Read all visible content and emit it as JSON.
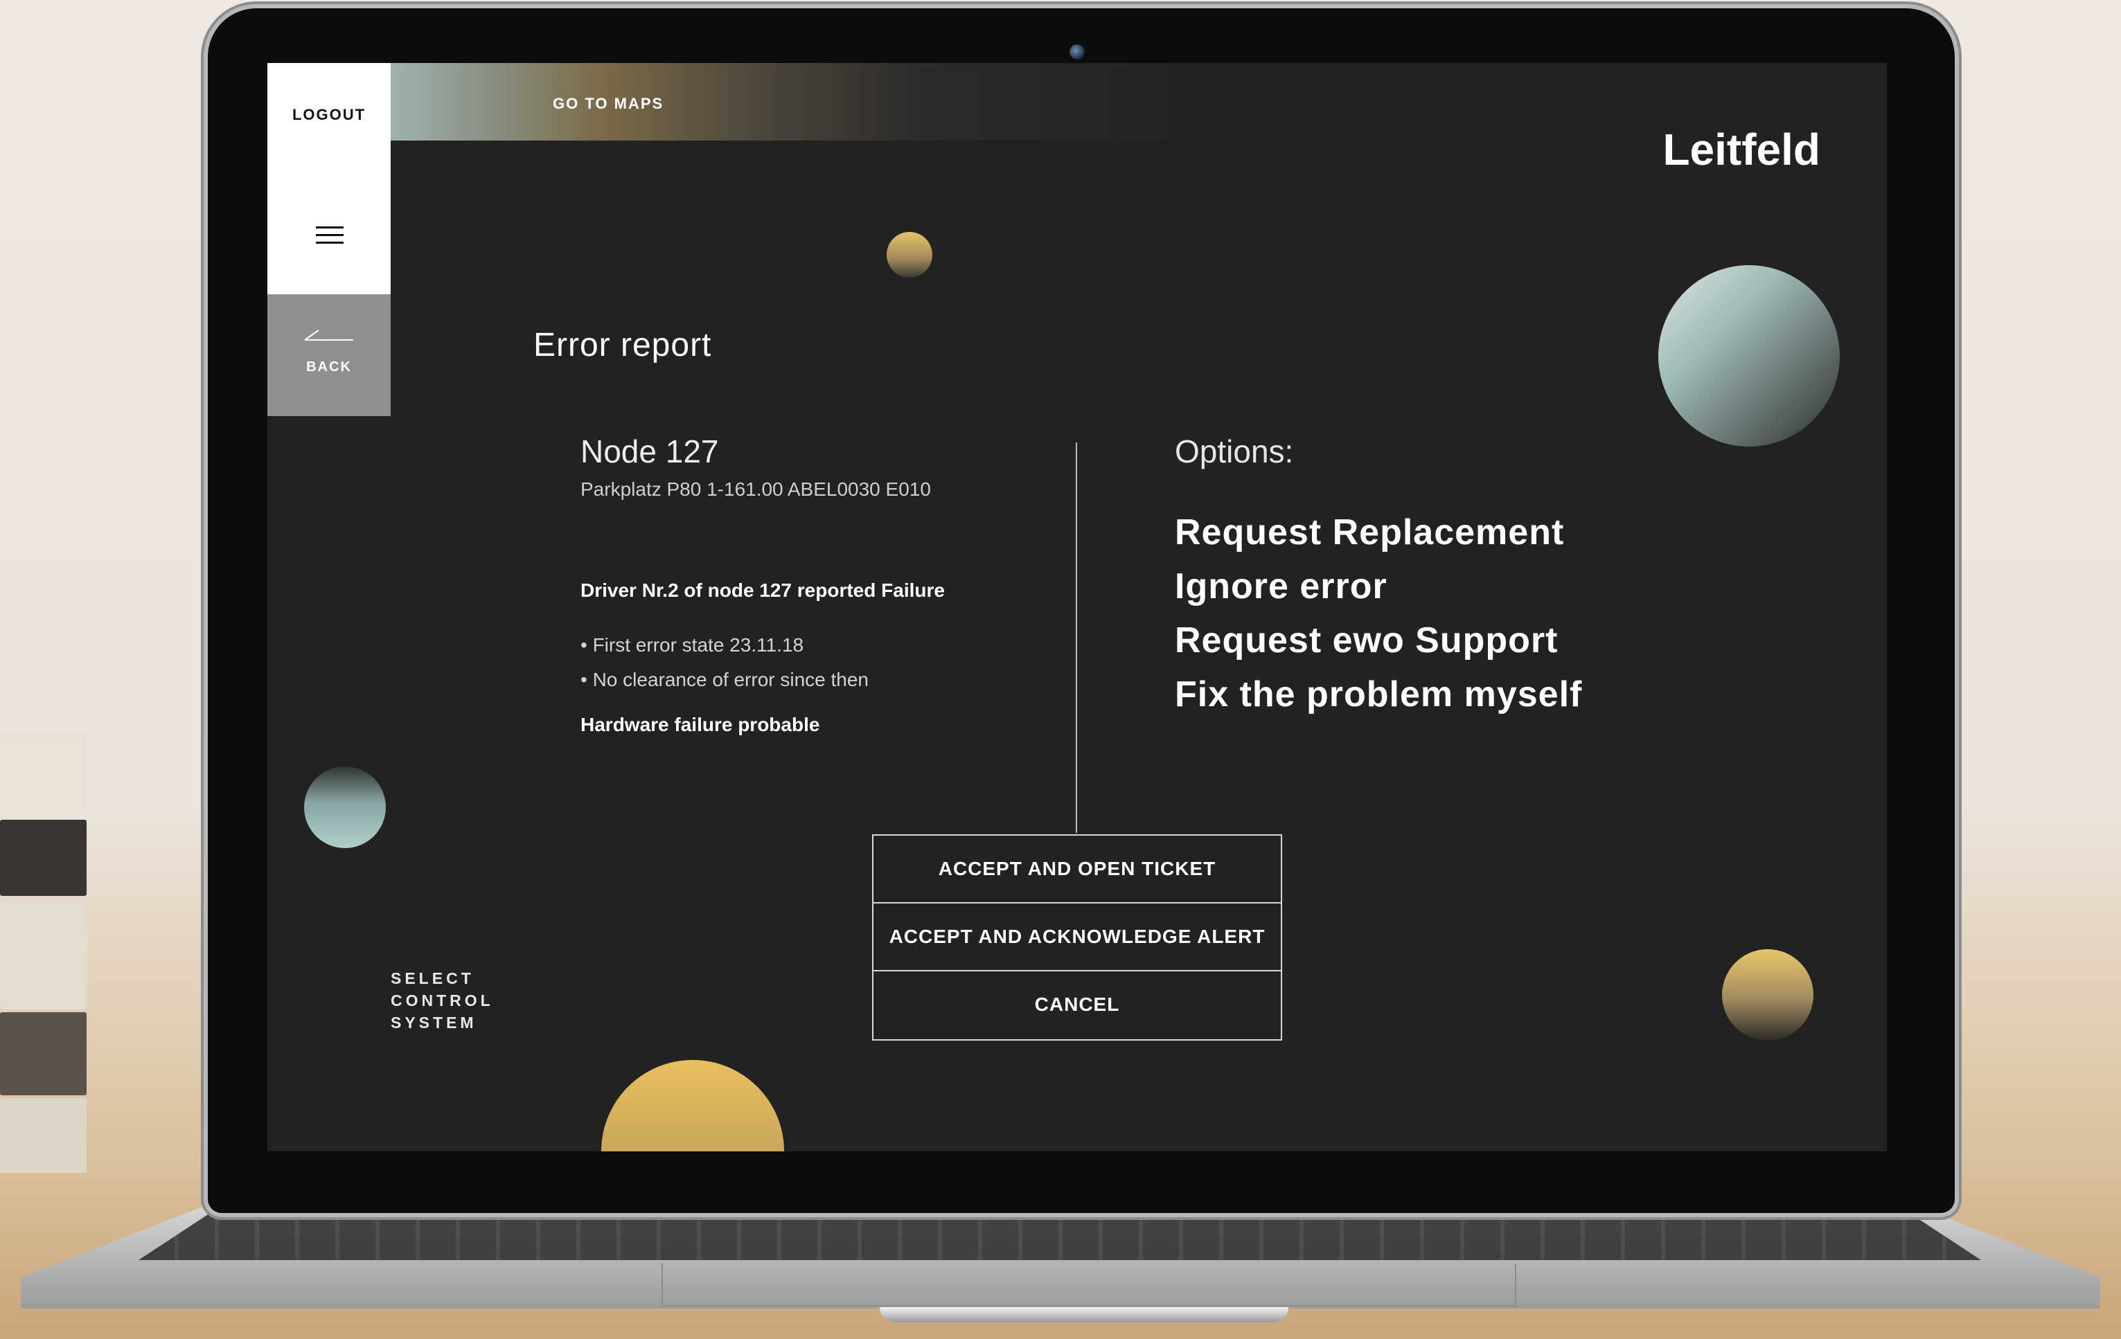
{
  "nav": {
    "logout_label": "LOGOUT",
    "goto_maps_label": "GO TO MAPS",
    "back_label": "BACK",
    "menu_icon": "hamburger-icon",
    "back_icon": "arrow-left-icon"
  },
  "brand": "Leitfeld",
  "page_title": "Error report",
  "node": {
    "title": "Node 127",
    "location": "Parkplatz P80 1-161.00 ABEL0030 E010",
    "driver_report": "Driver Nr.2 of node 127 reported Failure",
    "bullets": [
      "• First error state 23.11.18",
      "• No clearance of error since then"
    ],
    "conclusion": "Hardware failure probable"
  },
  "options": {
    "title": "Options:",
    "items": [
      "Request Replacement",
      "Ignore error",
      "Request ewo Support",
      "Fix the problem myself"
    ]
  },
  "actions": {
    "accept_open_ticket": "ACCEPT AND OPEN TICKET",
    "accept_acknowledge": "ACCEPT AND ACKNOWLEDGE ALERT",
    "cancel": "CANCEL"
  },
  "footer": {
    "select_control_system": [
      "SELECT",
      "CONTROL",
      "SYSTEM"
    ]
  },
  "colors": {
    "screen_bg": "#222223",
    "gold": "#e0bd63",
    "teal": "#a9c6c3",
    "sidebar_white": "#ffffff",
    "back_gray": "#8f8f90"
  }
}
